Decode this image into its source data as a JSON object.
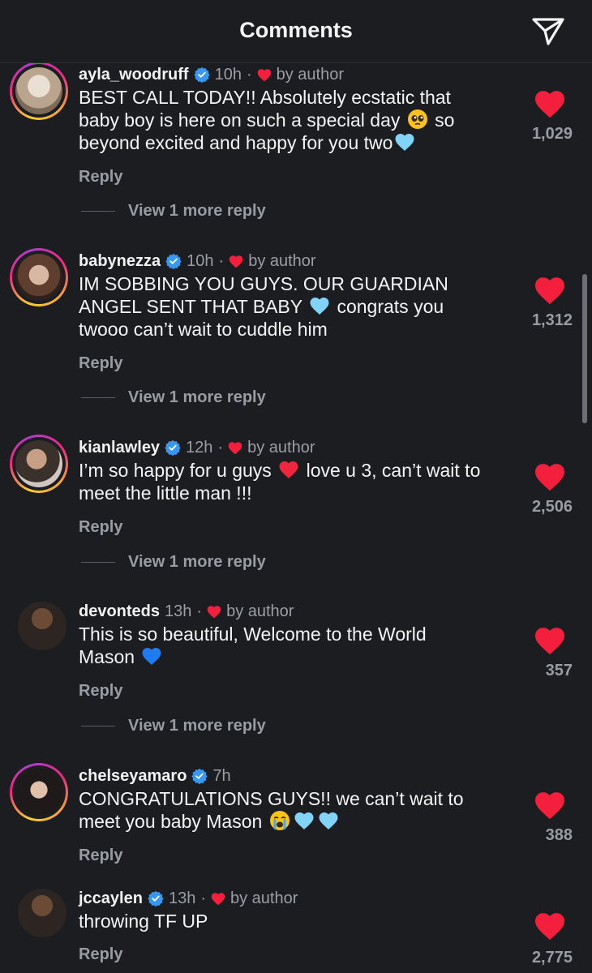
{
  "header": {
    "title": "Comments",
    "share_icon": "send-icon"
  },
  "colors": {
    "heart": "#f41e3d",
    "verified": "#3897f0",
    "muted": "#999ca2"
  },
  "comments": [
    {
      "username": "ayla_woodruff",
      "verified": true,
      "time": "10h",
      "liked_by_author": true,
      "by_author": "by author",
      "text_parts": [
        "BEST CALL TODAY!! Absolutely ecstatic that baby boy is here on such a special day ",
        " so beyond excited and happy for you two"
      ],
      "emojis": [
        "pleading-face",
        "light-blue-heart"
      ],
      "reply": "Reply",
      "view_more": "View 1 more reply",
      "likes": "1,029"
    },
    {
      "username": "babynezza",
      "verified": true,
      "time": "10h",
      "liked_by_author": true,
      "by_author": "by author",
      "text_parts": [
        "IM SOBBING YOU GUYS. OUR GUARDIAN ANGEL SENT THAT BABY ",
        " congrats you twooo can’t wait to cuddle him"
      ],
      "emojis": [
        "light-blue-heart"
      ],
      "reply": "Reply",
      "view_more": "View 1 more reply",
      "likes": "1,312"
    },
    {
      "username": "kianlawley",
      "verified": true,
      "time": "12h",
      "liked_by_author": true,
      "by_author": "by author",
      "text_parts": [
        "I’m so happy for u guys ",
        " love u 3, can’t wait to meet the little man !!!"
      ],
      "emojis": [
        "red-heart"
      ],
      "reply": "Reply",
      "view_more": "View 1 more reply",
      "likes": "2,506"
    },
    {
      "username": "devonteds",
      "verified": false,
      "time": "13h",
      "liked_by_author": true,
      "by_author": "by author",
      "text_parts": [
        "This is so beautiful, Welcome to the World Mason "
      ],
      "emojis": [
        "blue-heart"
      ],
      "reply": "Reply",
      "view_more": "View 1 more reply",
      "likes": "357"
    },
    {
      "username": "chelseyamaro",
      "verified": true,
      "time": "7h",
      "liked_by_author": false,
      "by_author": "",
      "text_parts": [
        "CONGRATULATIONS GUYS!! we can’t wait to meet you baby Mason "
      ],
      "emojis": [
        "crying-face",
        "light-blue-heart",
        "light-blue-heart"
      ],
      "reply": "Reply",
      "view_more": "",
      "likes": "388"
    },
    {
      "username": "jccaylen",
      "verified": true,
      "time": "13h",
      "liked_by_author": true,
      "by_author": "by author",
      "text_parts": [
        "throwing TF UP"
      ],
      "emojis": [],
      "reply": "Reply",
      "view_more": "",
      "likes": "2,775"
    }
  ]
}
